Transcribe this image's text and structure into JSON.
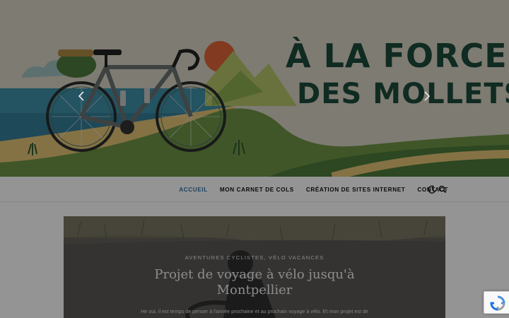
{
  "header": {
    "title_line1": "À LA FORCE",
    "title_line2": "DES MOLLETS"
  },
  "nav": {
    "items": [
      {
        "label": "ACCUEIL",
        "active": true
      },
      {
        "label": "MON CARNET DE COLS",
        "active": false
      },
      {
        "label": "CRÉATION DE SITES INTERNET",
        "active": false
      },
      {
        "label": "CONTACT",
        "active": false
      }
    ],
    "icons": [
      "moon-icon",
      "search-icon"
    ]
  },
  "slider": {
    "categories": [
      "AVENTURES CYCLISTES",
      "VÉLO VACANCES"
    ],
    "category_separator": ",",
    "title": "Projet de voyage à vélo jusqu'à Montpellier",
    "excerpt": "He oui, il est temps de penser à l'année prochaine et au prochain voyage à vélo. Et mon projet est de",
    "prev_icon": "chevron-left-icon",
    "next_icon": "chevron-right-icon"
  },
  "colors": {
    "title_green": "#1d4a3a",
    "nav_active": "#2f6fa0",
    "sun": "#e0643a",
    "sea": "#3f8fa8",
    "hill": "#7fa24a"
  },
  "badge": {
    "icon": "recaptcha-icon"
  }
}
